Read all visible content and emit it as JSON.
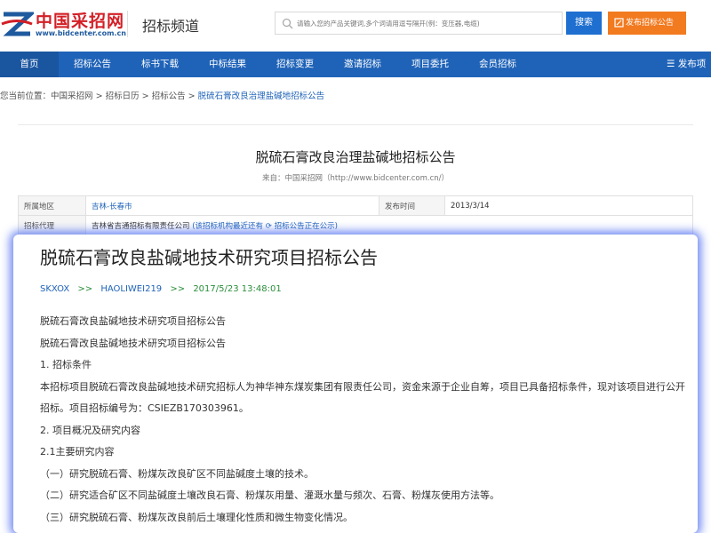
{
  "header": {
    "logo_cn": "中国采招网",
    "logo_url": "www.bidcenter.com.cn",
    "channel": "招标频道",
    "search_placeholder": "请输入您的产品关键词,多个词请用逗号隔开(例：变压器,电缆)",
    "search_button": "搜索",
    "publish_button": "发布招标公告",
    "colors": {
      "brand_red": "#d21f26",
      "nav_blue": "#1f63b8",
      "search_blue": "#1e6fd0",
      "publish_orange": "#f27a1f"
    }
  },
  "nav": {
    "items": [
      {
        "label": "首页",
        "active": true
      },
      {
        "label": "招标公告"
      },
      {
        "label": "标书下载"
      },
      {
        "label": "中标结果"
      },
      {
        "label": "招标变更"
      },
      {
        "label": "邀请招标"
      },
      {
        "label": "项目委托"
      },
      {
        "label": "会员招标"
      }
    ],
    "right_label": "发布项"
  },
  "breadcrumb": {
    "prefix": "您当前位置：",
    "items": [
      "中国采招网",
      "招标日历",
      "招标公告"
    ],
    "separator": ">",
    "current": "脱硫石膏改良治理盐碱地招标公告"
  },
  "background_page": {
    "title": "脱硫石膏改良治理盐碱地招标公告",
    "source": "来自：中国采招网（http://www.bidcenter.com.cn/）",
    "table": {
      "region_label": "所属地区",
      "region_value": "吉林-长春市",
      "time_label": "发布时间",
      "time_value": "2013/3/14",
      "agent_label": "招标代理",
      "agent_value": "吉林省吉通招标有限责任公司",
      "agent_note": "(该招标机构最近还有",
      "agent_link": "招标公告正在公示)"
    }
  },
  "card": {
    "title": "脱硫石膏改良盐碱地技术研究项目招标公告",
    "author1": "SKXOX",
    "author2": "HAOLIWEI219",
    "arrow": ">>",
    "datetime": "2017/5/23 13:48:01",
    "paragraphs": [
      "脱硫石膏改良盐碱地技术研究项目招标公告",
      "脱硫石膏改良盐碱地技术研究项目招标公告",
      "1.  招标条件",
      "本招标项目脱硫石膏改良盐碱地技术研究招标人为神华神东煤炭集团有限责任公司，资金来源于企业自筹，项目已具备招标条件，现对该项目进行公开招标。项目招标编号为：CSIEZB170303961。",
      "2.  项目概况及研究内容",
      "2.1主要研究内容",
      "（一）研究脱硫石膏、粉煤灰改良矿区不同盐碱度土壤的技术。",
      "（二）研究适合矿区不同盐碱度土壤改良石膏、粉煤灰用量、灌溉水量与频次、石膏、粉煤灰使用方法等。",
      "（三）研究脱硫石膏、粉煤灰改良前后土壤理化性质和微生物变化情况。"
    ]
  }
}
